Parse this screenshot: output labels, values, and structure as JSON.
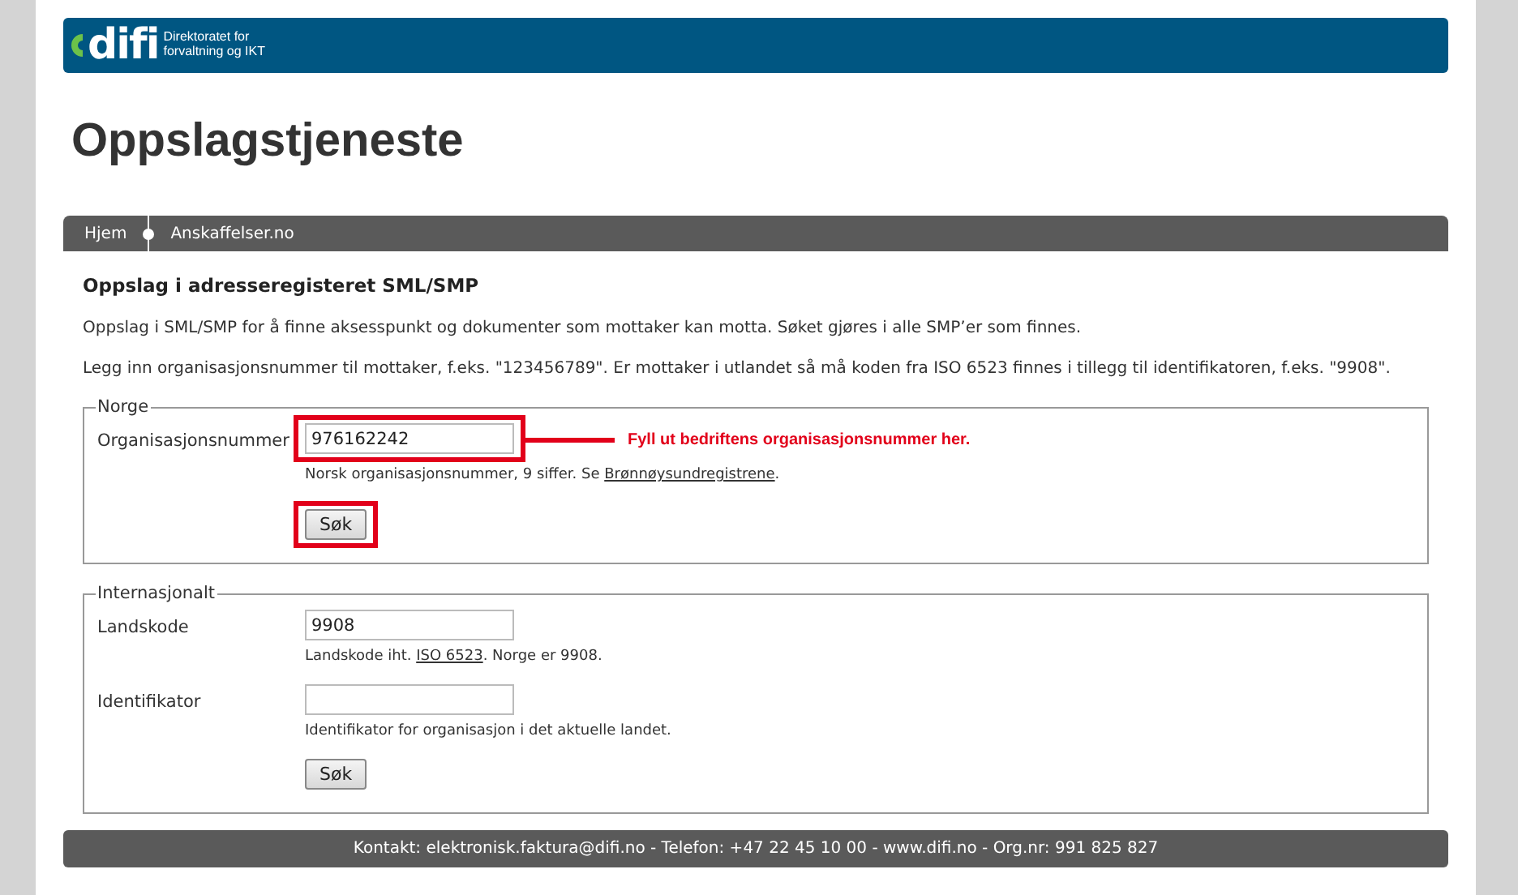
{
  "header": {
    "logo_mark": "difi",
    "logo_lines": [
      "Direktoratet for",
      "forvaltning og IKT"
    ]
  },
  "page_title": "Oppslagstjeneste",
  "nav": [
    {
      "label": "Hjem"
    },
    {
      "label": "Anskaffelser.no"
    }
  ],
  "heading": "Oppslag i adresseregisteret SML/SMP",
  "paragraphs": [
    "Oppslag i SML/SMP for å finne aksesspunkt og dokumenter som mottaker kan motta. Søket gjøres i alle SMP’er som finnes.",
    "Legg inn organisasjonsnummer til mottaker, f.eks. \"123456789\". Er mottaker i utlandet så må koden fra ISO 6523 finnes i tillegg til identifikatoren, f.eks. \"9908\"."
  ],
  "fieldsets": [
    {
      "legend": "Norge",
      "fields": [
        {
          "label": "Organisasjonsnummer",
          "value": "976162242",
          "highlighted": true,
          "hint": {
            "before": "Norsk organisasjonsnummer, 9 siffer. Se ",
            "link": "Brønnøysundregistrene",
            "after": "."
          }
        }
      ],
      "button": {
        "label": "Søk",
        "highlighted": true
      },
      "annotation": "Fyll ut bedriftens organisasjonsnummer her."
    },
    {
      "legend": "Internasjonalt",
      "fields": [
        {
          "label": "Landskode",
          "value": "9908",
          "highlighted": false,
          "hint": {
            "before": "Landskode iht. ",
            "link": "ISO 6523",
            "after": ". Norge er 9908."
          }
        },
        {
          "label": "Identifikator",
          "highlighted": false,
          "hint": {
            "before": "Identifikator for organisasjon i det aktuelle landet."
          }
        }
      ],
      "button": {
        "label": "Søk",
        "highlighted": false
      }
    }
  ],
  "footer": "Kontakt: elektronisk.faktura@difi.no - Telefon: +47 22 45 10 00 - www.difi.no - Org.nr: 991 825 827"
}
